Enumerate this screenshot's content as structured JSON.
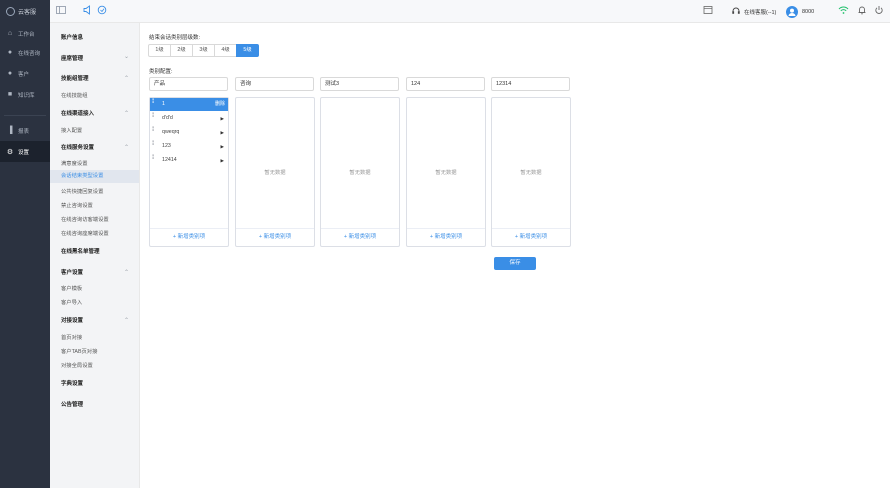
{
  "app": {
    "name": "云客服"
  },
  "topbar": {
    "agent_status": "在线客服(--1)",
    "agent_id": "8000"
  },
  "sidebar": {
    "items": [
      {
        "label": "工作台",
        "icon": "home-icon"
      },
      {
        "label": "在线咨询",
        "icon": "chat-icon"
      },
      {
        "label": "客户",
        "icon": "user-icon"
      },
      {
        "label": "知识库",
        "icon": "book-icon"
      },
      {
        "label": "报表",
        "icon": "chart-icon"
      },
      {
        "label": "设置",
        "icon": "gear-icon"
      }
    ]
  },
  "subnav": {
    "account_info": "账户信息",
    "seat_mgmt": "座席管理",
    "skill_group_mgmt": "技能组管理",
    "online_skill_group": "在线技能组",
    "online_channel_access": "在线渠道接入",
    "access_config": "接入配置",
    "online_service_settings": "在线服务设置",
    "satisfaction_settings": "满意度设置",
    "session_end_type_settings": "会话结束类型设置",
    "common_quick_reply_settings": "公共快捷回复设置",
    "forbidden_consult_settings": "禁止咨询设置",
    "visitor_chat_window_settings": "在线咨询访客端设置",
    "agent_chat_window_settings": "在线咨询座席端设置",
    "online_blacklist_mgmt": "在线黑名单管理",
    "customer_settings": "客户设置",
    "customer_template": "客户模板",
    "customer_import": "客户导入",
    "integration_settings": "对接设置",
    "homepage_integration": "首页对接",
    "customer_tab_integration": "客户TAB页对接",
    "global_integration_settings": "对接全局设置",
    "dictionary_settings": "字典设置",
    "announcement_mgmt": "公告管理"
  },
  "main": {
    "levels_label": "结束会话类别层级数:",
    "levels": [
      "1级",
      "2级",
      "3级",
      "4级",
      "5级"
    ],
    "active_level": "5级",
    "category_config_label": "类别配置:",
    "categories": [
      "产品",
      "咨询",
      "测试3",
      "124",
      "12314"
    ],
    "first_panel_items": [
      {
        "label": "1",
        "action": "删除"
      },
      {
        "label": "d'd'd"
      },
      {
        "label": "qweqrq"
      },
      {
        "label": "123"
      },
      {
        "label": "12414"
      }
    ],
    "empty_text": "暂无数据",
    "add_item_label": "+ 新增类别项",
    "save_label": "保存"
  }
}
